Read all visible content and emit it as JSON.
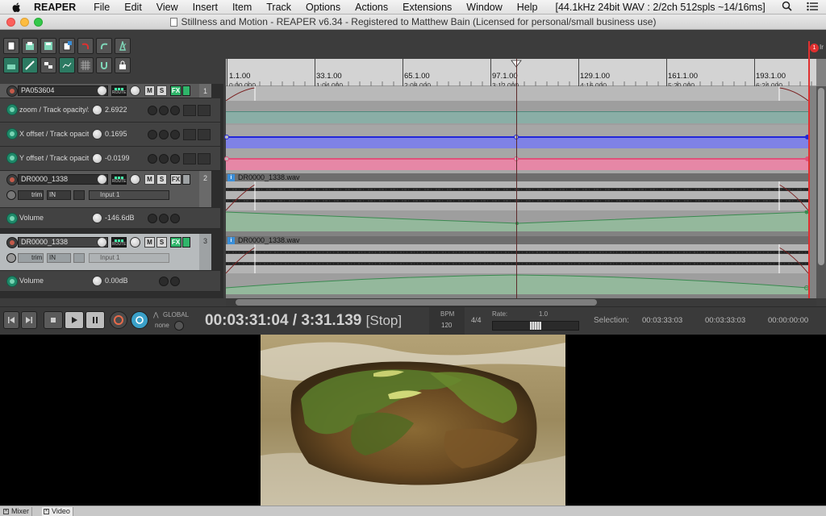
{
  "menubar": {
    "app_name": "REAPER",
    "items": [
      "File",
      "Edit",
      "View",
      "Insert",
      "Item",
      "Track",
      "Options",
      "Actions",
      "Extensions",
      "Window",
      "Help"
    ],
    "status": "[44.1kHz 24bit WAV : 2/2ch 512spls ~14/16ms]"
  },
  "window": {
    "title": "Stillness and Motion - REAPER v6.34 - Registered to Matthew Bain (Licensed for personal/small business use)"
  },
  "ruler": {
    "marks": [
      {
        "bar": "1.1.00",
        "time": "0:00.000"
      },
      {
        "bar": "33.1.00",
        "time": "1:04.000"
      },
      {
        "bar": "65.1.00",
        "time": "2:08.000"
      },
      {
        "bar": "97.1.00",
        "time": "3:12.000"
      },
      {
        "bar": "129.1.00",
        "time": "4:16.000"
      },
      {
        "bar": "161.1.00",
        "time": "5:20.000"
      },
      {
        "bar": "193.1.00",
        "time": "6:24.000"
      }
    ],
    "marker_label": "Ir"
  },
  "tracks": {
    "video": {
      "name": "PA053604",
      "number": "1",
      "fx": "FX",
      "mute": "M",
      "solo": "S",
      "route": "ROUTE",
      "envelopes": [
        {
          "label": "zoom / Track opacity/zoom",
          "value": "2.6922"
        },
        {
          "label": "X offset / Track opacity/zoom",
          "value": "0.1695"
        },
        {
          "label": "Y offset / Track opacity/zoom",
          "value": "-0.0199"
        }
      ]
    },
    "audio1": {
      "name": "DR0000_1338",
      "number": "2",
      "fx": "FX",
      "mute": "M",
      "solo": "S",
      "route": "ROUTE",
      "trim": "trim",
      "in": "IN",
      "input": "Input 1",
      "item_name": "DR0000_1338.wav",
      "envelope": {
        "label": "Volume",
        "value": "-146.6dB"
      }
    },
    "audio2": {
      "name": "DR0000_1338",
      "number": "3",
      "fx": "FX",
      "mute": "M",
      "solo": "S",
      "route": "ROUTE",
      "trim": "trim",
      "in": "IN",
      "input": "Input 1",
      "item_name": "DR0000_1338.wav",
      "envelope": {
        "label": "Volume",
        "value": "0.00dB"
      }
    }
  },
  "transport": {
    "global_label": "GLOBAL",
    "global_value": "none",
    "time_main": "00:03:31:04 / 3:31.139",
    "state": "[Stop]",
    "bpm_label": "BPM",
    "bpm_value": "120",
    "timesig": "4/4",
    "rate_label": "Rate:",
    "rate_value": "1.0",
    "selection_label": "Selection:",
    "sel_start": "00:03:33:03",
    "sel_end": "00:03:33:03",
    "sel_length": "00:00:00:00"
  },
  "bottom_tabs": {
    "mixer": "Mixer",
    "video": "Video"
  },
  "colors": {
    "accent_green": "#2fb56a",
    "zoom_env": "#5aa89a",
    "x_env": "#4a4ee0",
    "y_env": "#e0507a",
    "volume_env": "#4e9a62",
    "end_marker": "#e03030"
  }
}
